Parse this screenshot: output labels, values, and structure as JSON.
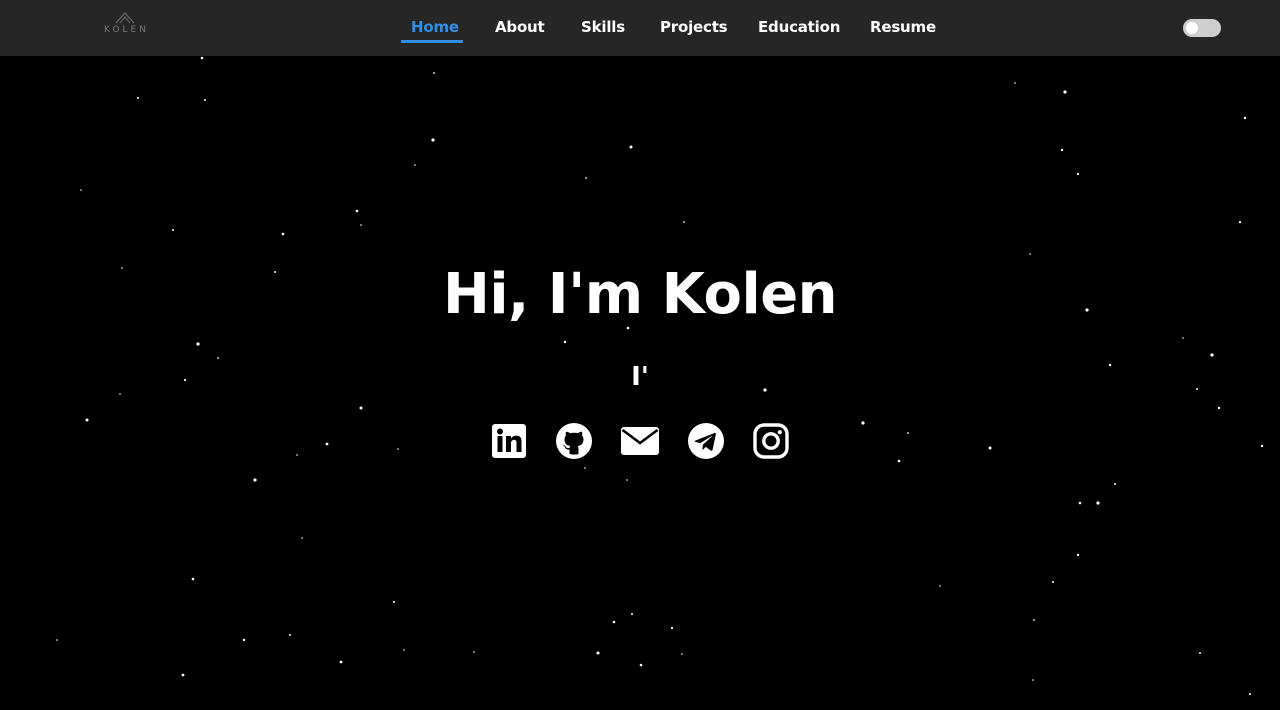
{
  "brand": {
    "logo_text": "KOLEN"
  },
  "nav": {
    "items": [
      {
        "label": "Home",
        "active": true
      },
      {
        "label": "About",
        "active": false
      },
      {
        "label": "Skills",
        "active": false
      },
      {
        "label": "Projects",
        "active": false
      },
      {
        "label": "Education",
        "active": false
      },
      {
        "label": "Resume",
        "active": false
      }
    ],
    "theme_toggle": {
      "state": "off"
    }
  },
  "hero": {
    "title": "Hi, I'm Kolen",
    "typed_text": "I'"
  },
  "socials": [
    {
      "name": "linkedin-icon"
    },
    {
      "name": "github-icon"
    },
    {
      "name": "mail-icon"
    },
    {
      "name": "telegram-icon"
    },
    {
      "name": "instagram-icon"
    }
  ],
  "colors": {
    "background": "#000000",
    "navbar": "#262626",
    "accent": "#2f8fe6",
    "text": "#ffffff"
  }
}
